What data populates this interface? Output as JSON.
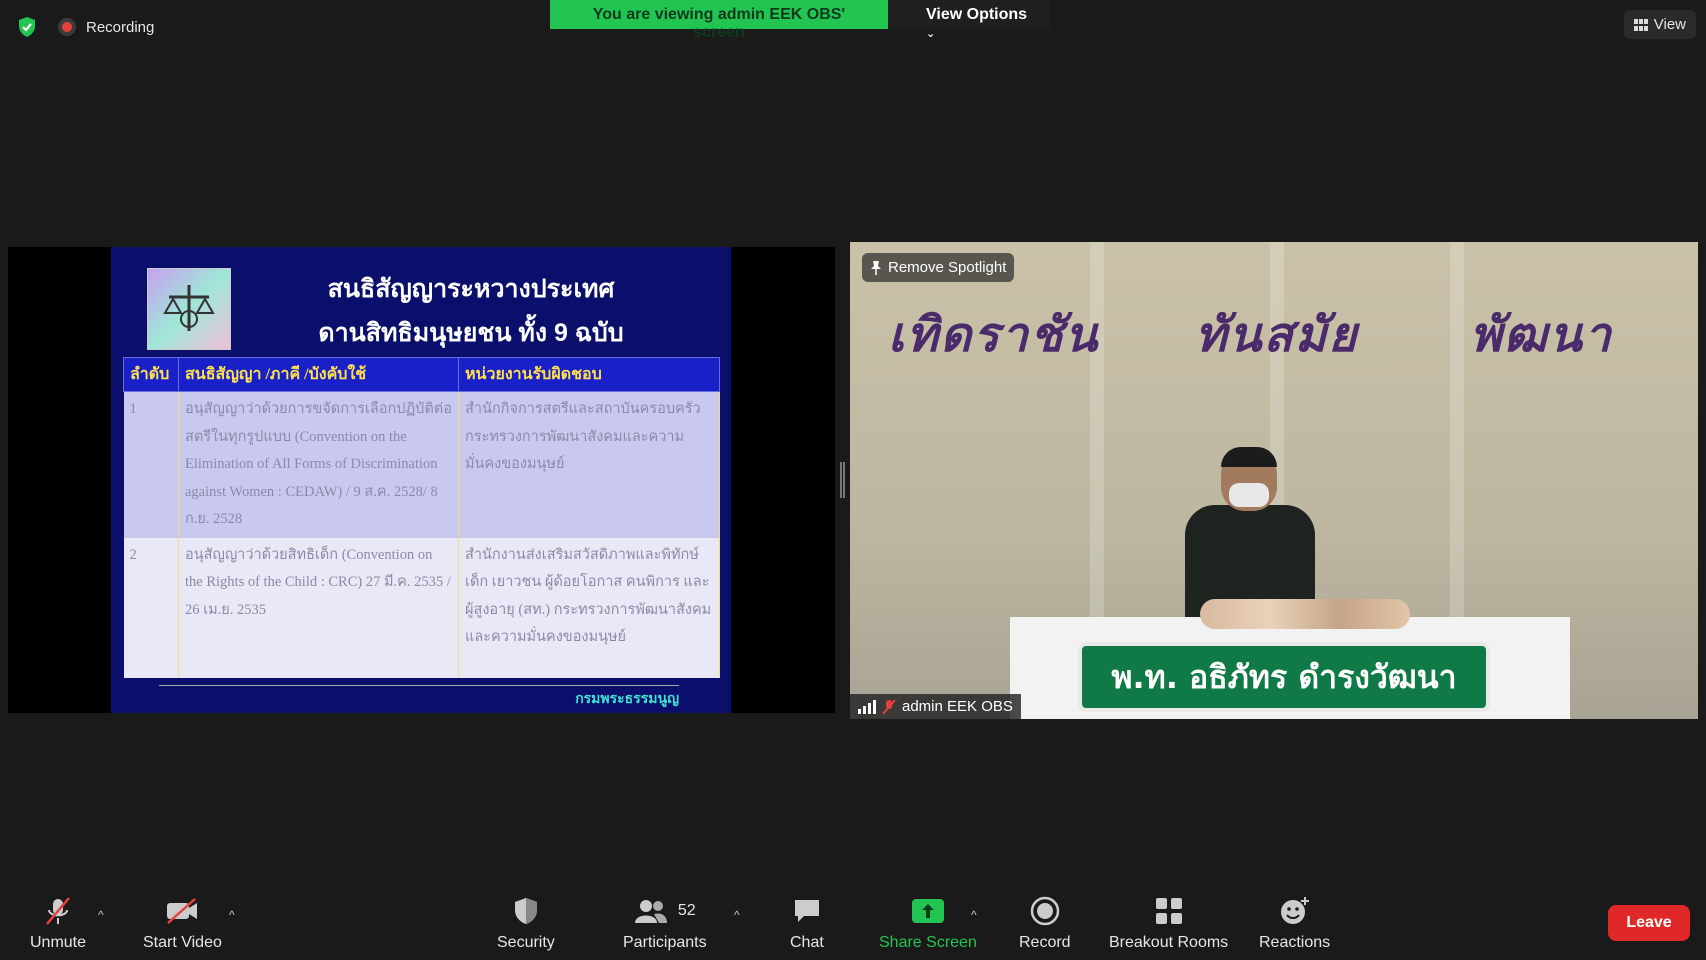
{
  "top": {
    "recording_label": "Recording",
    "banner_text": "You are viewing admin EEK OBS' screen",
    "view_options_label": "View Options",
    "view_label": "View"
  },
  "slide": {
    "title_line1": "สนธิสัญญาระหวางประเทศ",
    "title_line2": "ดานสิทธิมนุษยชน ทั้ง 9 ฉบับ",
    "headers": [
      "ลำดับ",
      "สนธิสัญญา /ภาคี /บังคับใช้",
      "หน่วยงานรับผิดชอบ"
    ],
    "rows": [
      {
        "no": "1",
        "treaty": "อนุสัญญาว่าด้วยการขจัดการเลือกปฏิบัติต่อสตรีในทุกรูปแบบ (Convention on the Elimination of All Forms of Discrimination against Women : CEDAW) / 9 ส.ค. 2528/ 8 ก.ย. 2528",
        "agency": "สำนักกิจการสตรีและสถาบันครอบครัว กระทรวงการพัฒนาสังคมและความมั่นคงของมนุษย์"
      },
      {
        "no": "2",
        "treaty": "อนุสัญญาว่าด้วยสิทธิเด็ก (Convention on the Rights of the Child : CRC) 27 มี.ค. 2535 / 26 เม.ย. 2535",
        "agency": "สำนักงานส่งเสริมสวัสดิภาพและพิทักษ์เด็ก เยาวชน ผู้ด้อยโอกาส คนพิการ และผู้สูงอายุ (สท.) กระทรวงการพัฒนาสังคม และความมั่นคงของมนุษย์"
      }
    ],
    "footer": "กรมพระธรรมนูญ"
  },
  "video": {
    "wall_words": [
      "เทิดราชัน",
      "ทันสมัย",
      "พัฒนา"
    ],
    "nameplate": "พ.ท. อธิภัทร ดำรงวัฒนา",
    "spotlight_label": "Remove Spotlight",
    "participant_name": "admin EEK OBS"
  },
  "toolbar": {
    "unmute": "Unmute",
    "start_video": "Start Video",
    "security": "Security",
    "participants": "Participants",
    "participants_count": "52",
    "chat": "Chat",
    "share_screen": "Share Screen",
    "record": "Record",
    "breakout_rooms": "Breakout Rooms",
    "reactions": "Reactions",
    "leave": "Leave"
  },
  "colors": {
    "banner_green": "#23c552",
    "leave_red": "#e02828",
    "share_green": "#23c552",
    "slide_navy": "#0a0f6b"
  }
}
